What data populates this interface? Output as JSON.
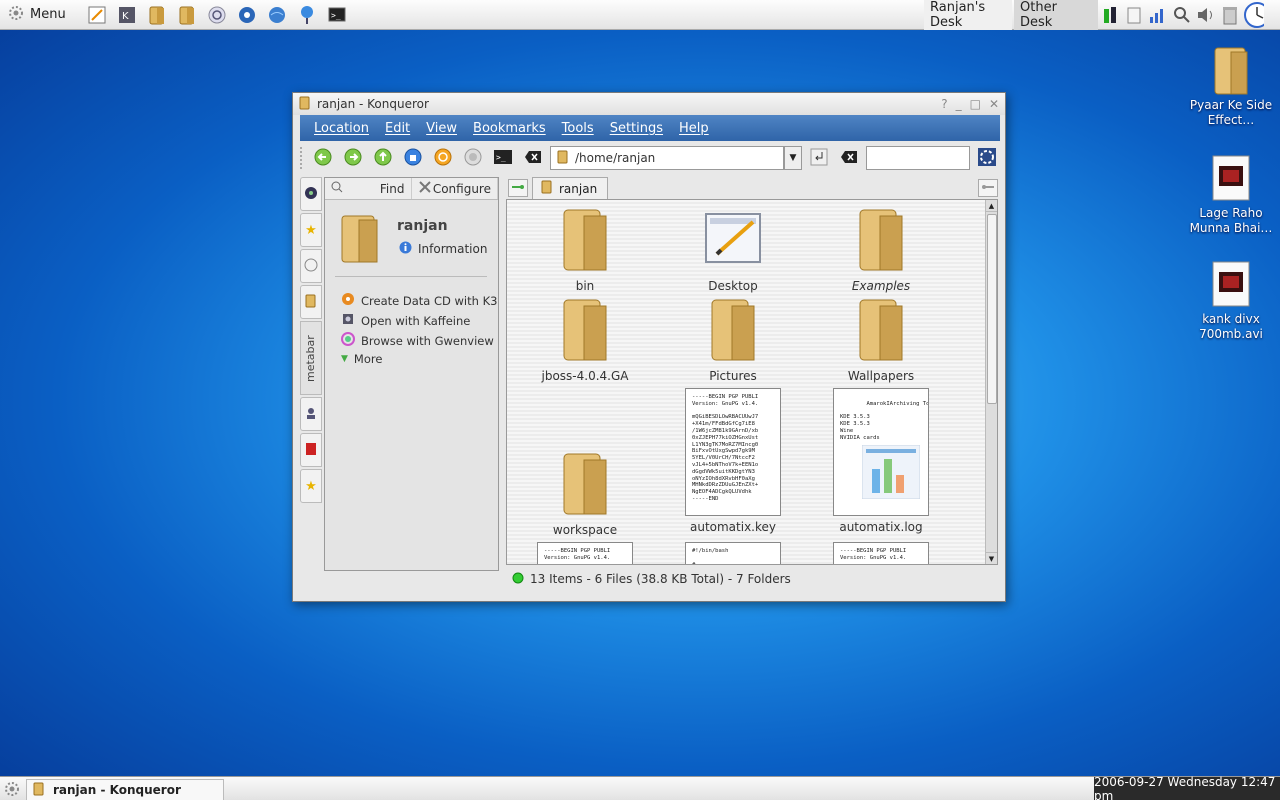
{
  "top_panel": {
    "menu_label": "Menu",
    "quicklaunch": [
      "text-editor-icon",
      "kicker-icon",
      "home-folder-icon",
      "folder-icon",
      "help-icon",
      "kde-icon",
      "web-browser-icon",
      "network-icon",
      "terminal-icon"
    ],
    "desktops": [
      "Ranjan's Desk",
      "Other Desk"
    ],
    "tray": [
      "power-icon",
      "klipper-icon",
      "network-signal-icon",
      "search-icon",
      "volume-icon",
      "trash-icon",
      "clock-icon"
    ]
  },
  "desktop_icons": [
    {
      "label": "Pyaar Ke Side Effect…",
      "icon": "folder-icon"
    },
    {
      "label": "Lage Raho Munna Bhai…",
      "icon": "video-file-icon"
    },
    {
      "label": "kank divx 700mb.avi",
      "icon": "video-file-icon"
    }
  ],
  "window": {
    "title": "ranjan - Konqueror",
    "controls": [
      "?",
      "_",
      "□",
      "✕"
    ],
    "menus": [
      "Location",
      "Edit",
      "View",
      "Bookmarks",
      "Tools",
      "Settings",
      "Help"
    ],
    "location": "/home/ranjan",
    "search_value": ""
  },
  "metabar": {
    "find_label": "Find",
    "configure_label": "Configure",
    "title": "ranjan",
    "info_label": "Information",
    "actions": [
      {
        "label": "Create Data CD with K3",
        "icon": "k3b-icon"
      },
      {
        "label": "Open with Kaffeine",
        "icon": "kaffeine-icon"
      },
      {
        "label": "Browse with Gwenview",
        "icon": "gwenview-icon"
      },
      {
        "label": "More",
        "icon": "chevron-down-icon"
      }
    ],
    "tab_label": "metabar"
  },
  "file_tab": "ranjan",
  "files": [
    {
      "name": "bin",
      "type": "folder"
    },
    {
      "name": "Desktop",
      "type": "desktop"
    },
    {
      "name": "Examples",
      "type": "folder"
    },
    {
      "name": "jboss-4.0.4.GA",
      "type": "folder"
    },
    {
      "name": "Pictures",
      "type": "folder"
    },
    {
      "name": "Wallpapers",
      "type": "folder"
    },
    {
      "name": "workspace",
      "type": "folder"
    },
    {
      "name": "automatix.key",
      "type": "key"
    },
    {
      "name": "automatix.log",
      "type": "log"
    }
  ],
  "key_preview": "-----BEGIN PGP PUBLI\nVersion: GnuPG v1.4.\n\nmQGiBESDLOwRBACUUwJ7\n+X41m/FFdBdGfCg7iE8\n/1W6jcZM81k9GArnD/xb\n0xZJEPH77kiOZHGnxUst\nL1YN3gTK7MoRZ7MIncg0\nBiFxvOtUxgSwpd7gk9M\n5YEL/V0UrCH/7NtccF2\nvJL4+5bNThoV7k+EEN1o\ndGgdVWk5uitKKDgtYN3\noNYzIOh8dXRvbHF0aXg\nMHNkdDRzZDUuGJEnZXt+\nNgEOF4ADCgkQLUVdhk\n-----END",
  "log_preview": "AmarokIArchiving Too\n\nKDE 3.5.3\nKDE 3.5.3\nWine\nNVIDIA cards",
  "partial_previews": [
    "-----BEGIN PGP PUBLI\nVersion: GnuPG v1.4.",
    "#!/bin/bash\n\n# ...",
    "-----BEGIN PGP PUBLI\nVersion: GnuPG v1.4."
  ],
  "status": "13 Items - 6 Files (38.8 KB Total) - 7 Folders",
  "taskbar": {
    "task_label": "ranjan - Konqueror",
    "clock": "2006-09-27 Wednesday 12:47 pm"
  }
}
